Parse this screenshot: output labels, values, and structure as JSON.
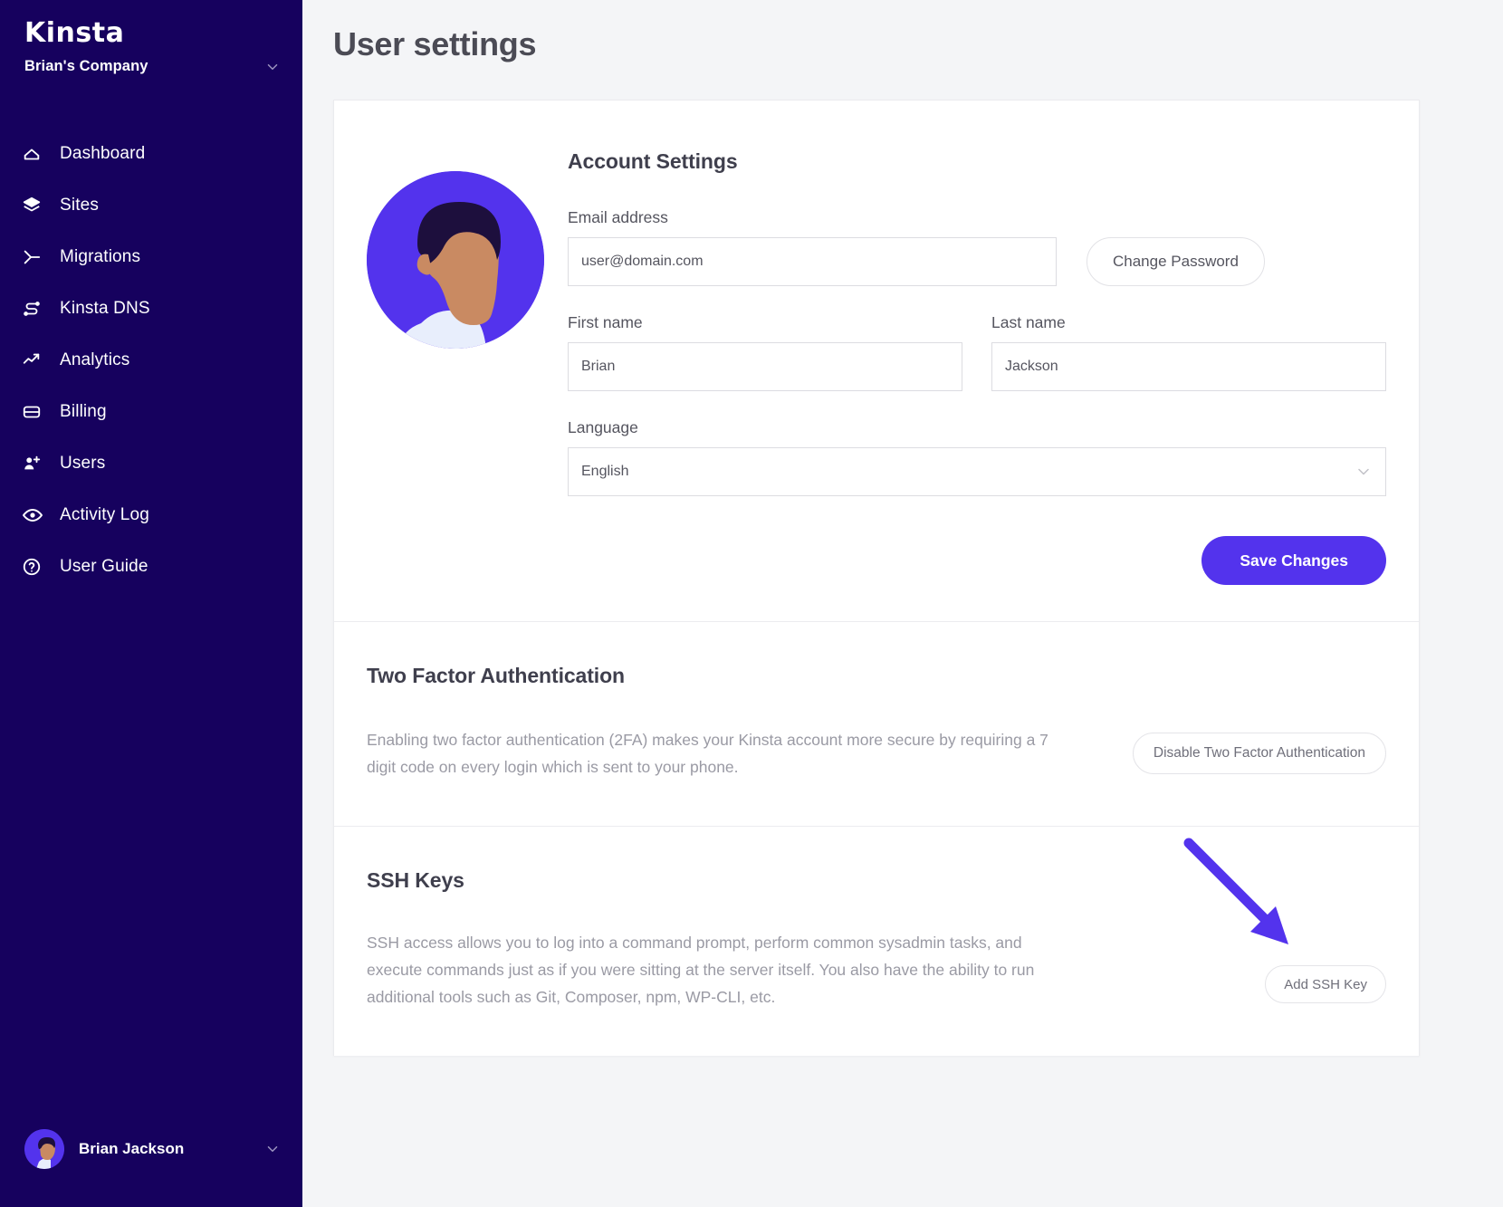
{
  "sidebar": {
    "logo_text": "Kinsta",
    "company": "Brian's Company",
    "company_caret_icon": "chevron-down-icon",
    "items": [
      {
        "label": "Dashboard",
        "icon": "home-icon"
      },
      {
        "label": "Sites",
        "icon": "layers-icon"
      },
      {
        "label": "Migrations",
        "icon": "migration-arrow-icon"
      },
      {
        "label": "Kinsta DNS",
        "icon": "dns-nodes-icon"
      },
      {
        "label": "Analytics",
        "icon": "trending-up-icon"
      },
      {
        "label": "Billing",
        "icon": "credit-card-icon"
      },
      {
        "label": "Users",
        "icon": "user-plus-icon"
      },
      {
        "label": "Activity Log",
        "icon": "eye-icon"
      },
      {
        "label": "User Guide",
        "icon": "question-circle-icon"
      }
    ],
    "user": {
      "name": "Brian Jackson",
      "avatar_icon": "avatar",
      "caret_icon": "chevron-down-icon"
    }
  },
  "main": {
    "page_title": "User settings",
    "account": {
      "title": "Account Settings",
      "avatar_icon": "user-illustration-avatar",
      "email_label": "Email address",
      "email_value": "user@domain.com",
      "change_password_label": "Change Password",
      "first_name_label": "First name",
      "first_name_value": "Brian",
      "last_name_label": "Last name",
      "last_name_value": "Jackson",
      "language_label": "Language",
      "language_value": "English",
      "language_caret_icon": "chevron-down-icon",
      "save_label": "Save Changes"
    },
    "two_factor": {
      "title": "Two Factor Authentication",
      "description": "Enabling two factor authentication (2FA) makes your Kinsta account more secure by requiring a 7 digit code on every login which is sent to your phone.",
      "button_label": "Disable Two Factor Authentication"
    },
    "ssh": {
      "title": "SSH Keys",
      "description": "SSH access allows you to log into a command prompt, perform common sysadmin tasks, and execute commands just as if you were sitting at the server itself. You also have the ability to run additional tools such as Git, Composer, npm, WP-CLI, etc.",
      "button_label": "Add SSH Key",
      "annotation_icon": "purple-arrow-annotation"
    }
  },
  "colors": {
    "sidebar_bg": "#16015e",
    "accent_purple": "#5333ed",
    "page_bg": "#f4f5f7",
    "card_bg": "#ffffff",
    "muted_text": "#9a9aa4",
    "heading_text": "#4b4b55"
  }
}
